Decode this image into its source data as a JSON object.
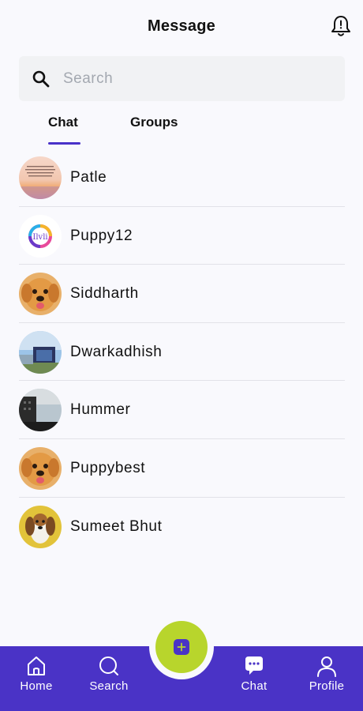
{
  "header": {
    "title": "Message",
    "bell_icon": "bell-icon"
  },
  "search": {
    "placeholder": "Search",
    "value": "",
    "icon": "search-icon"
  },
  "tabs": [
    {
      "label": "Chat",
      "active": true
    },
    {
      "label": "Groups",
      "active": false
    }
  ],
  "chats": [
    {
      "name": "Patle",
      "avatar": "sunset-quote-image"
    },
    {
      "name": "Puppy12",
      "avatar": "colorful-logo-image"
    },
    {
      "name": "Siddharth",
      "avatar": "golden-puppy-image"
    },
    {
      "name": "Dwarkadhish",
      "avatar": "sky-photo-image"
    },
    {
      "name": "Hummer",
      "avatar": "building-sky-image"
    },
    {
      "name": "Puppybest",
      "avatar": "golden-puppy-image"
    },
    {
      "name": "Sumeet Bhut",
      "avatar": "beagle-image"
    }
  ],
  "fab": {
    "icon": "plus-icon"
  },
  "nav": [
    {
      "label": "Home",
      "icon": "home-icon"
    },
    {
      "label": "Search",
      "icon": "search-icon"
    },
    {
      "label": "Chat",
      "icon": "chat-bubble-icon"
    },
    {
      "label": "Profile",
      "icon": "user-icon"
    }
  ],
  "colors": {
    "accent": "#4a33c6",
    "fab": "#b8d52c",
    "background": "#f9f9fd"
  }
}
